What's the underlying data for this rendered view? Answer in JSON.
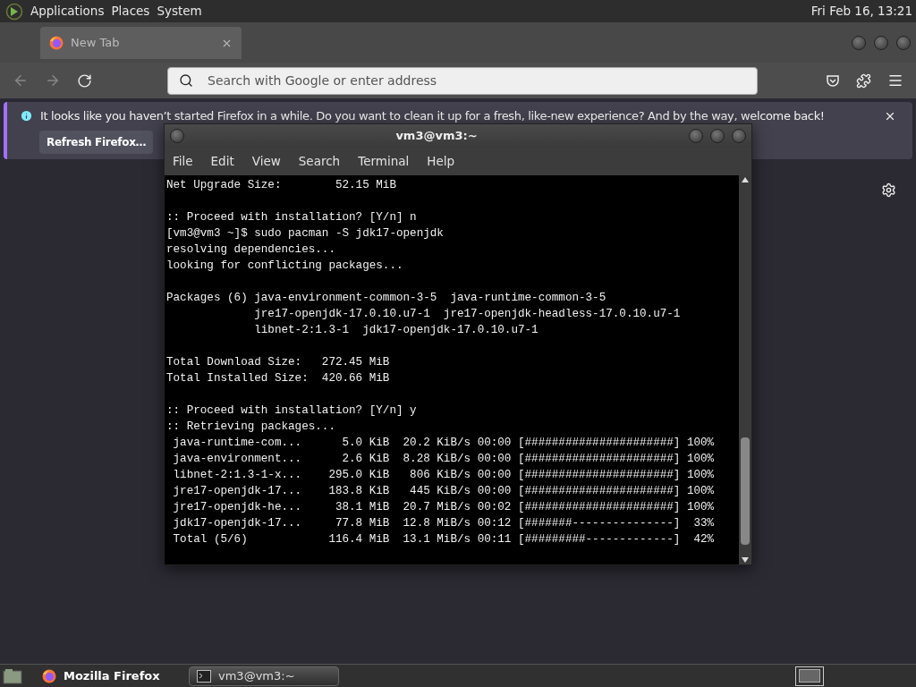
{
  "top_panel": {
    "menus": [
      "Applications",
      "Places",
      "System"
    ],
    "clock": "Fri Feb 16, 13:21"
  },
  "browser": {
    "tabs": [
      {
        "label": "New Tab",
        "selected": true
      }
    ],
    "address_placeholder": "Search with Google or enter address",
    "notification": {
      "message": "It looks like you haven’t started Firefox in a while. Do you want to clean it up for a fresh, like-new experience? And by the way, welcome back!",
      "button": "Refresh Firefox…"
    }
  },
  "terminal": {
    "title": "vm3@vm3:~",
    "menu": [
      "File",
      "Edit",
      "View",
      "Search",
      "Terminal",
      "Help"
    ],
    "blocks": [
      [
        "Net Upgrade Size:        52.15 MiB"
      ],
      [
        ":: Proceed with installation? [Y/n] n",
        "[vm3@vm3 ~]$ sudo pacman -S jdk17-openjdk",
        "resolving dependencies...",
        "looking for conflicting packages..."
      ],
      [
        "Packages (6) java-environment-common-3-5  java-runtime-common-3-5",
        "             jre17-openjdk-17.0.10.u7-1  jre17-openjdk-headless-17.0.10.u7-1",
        "             libnet-2:1.3-1  jdk17-openjdk-17.0.10.u7-1"
      ],
      [
        "Total Download Size:   272.45 MiB",
        "Total Installed Size:  420.66 MiB"
      ],
      [
        ":: Proceed with installation? [Y/n] y",
        ":: Retrieving packages...",
        " java-runtime-com...      5.0 KiB  20.2 KiB/s 00:00 [######################] 100%",
        " java-environment...      2.6 KiB  8.28 KiB/s 00:00 [######################] 100%",
        " libnet-2:1.3-1-x...    295.0 KiB   806 KiB/s 00:00 [######################] 100%",
        " jre17-openjdk-17...    183.8 KiB   445 KiB/s 00:00 [######################] 100%",
        " jre17-openjdk-he...     38.1 MiB  20.7 MiB/s 00:02 [######################] 100%",
        " jdk17-openjdk-17...     77.8 MiB  12.8 MiB/s 00:12 [#######---------------]  33%",
        " Total (5/6)            116.4 MiB  13.1 MiB/s 00:11 [#########-------------]  42%"
      ]
    ]
  },
  "taskbar": {
    "items": [
      {
        "kind": "firefox",
        "label": "Mozilla Firefox",
        "selected": false
      },
      {
        "kind": "terminal",
        "label": "vm3@vm3:~",
        "selected": true
      }
    ]
  }
}
